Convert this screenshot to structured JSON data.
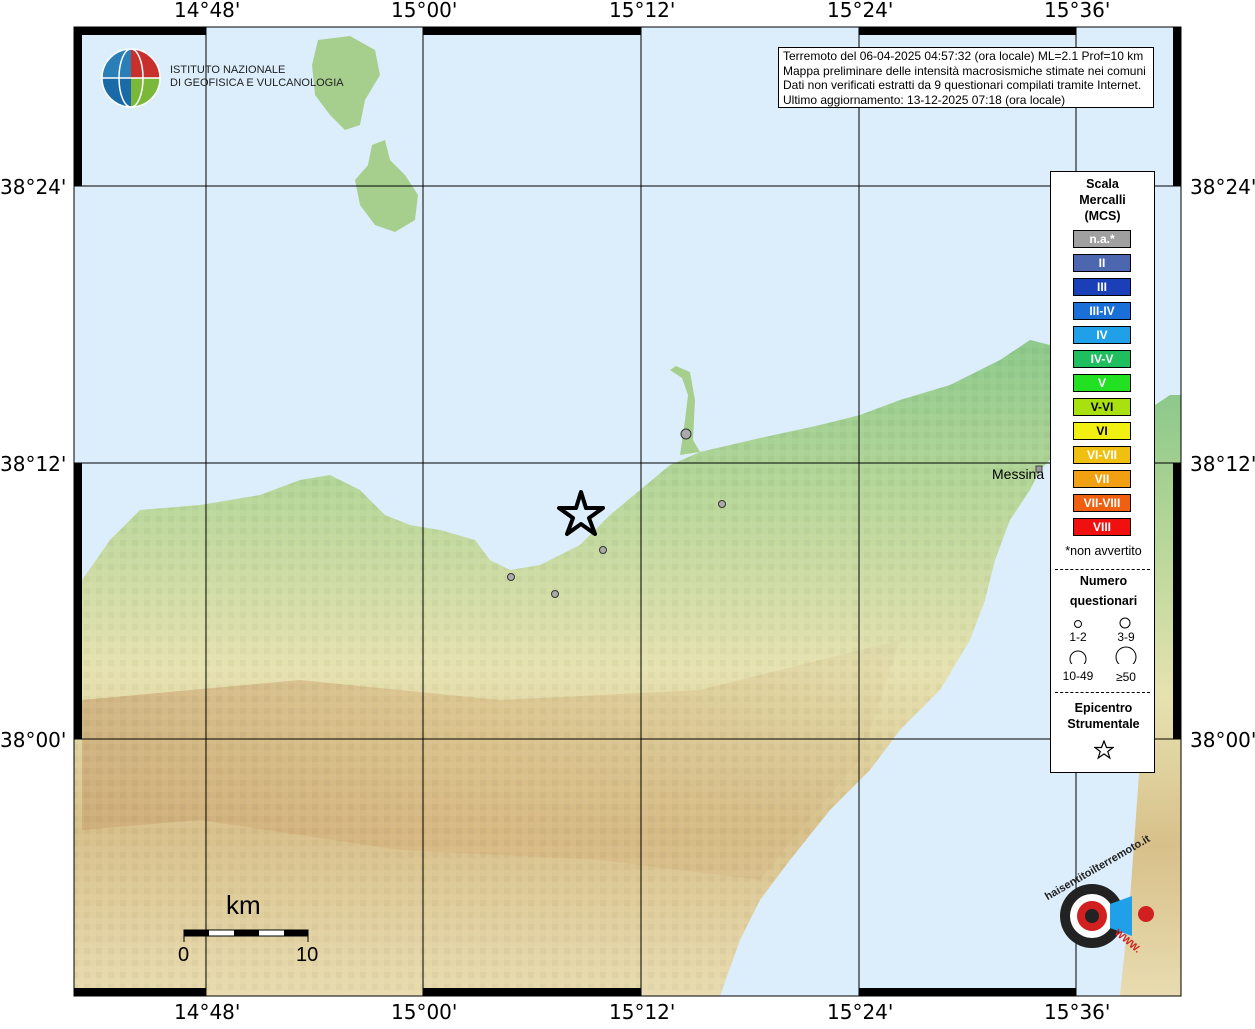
{
  "header": {
    "lon_labels": [
      "14°48'",
      "15°00'",
      "15°12'",
      "15°24'",
      "15°36'"
    ],
    "lat_labels": [
      "38°24'",
      "38°12'",
      "38°00'"
    ]
  },
  "info": {
    "line1": "Terremoto del 06-04-2025 04:57:32 (ora locale) ML=2.1 Prof=10 km",
    "line2": "Mappa preliminare delle intensità macrosismiche stimate nei comuni",
    "line3": "Dati non verificati estratti da 9 questionari compilati tramite Internet.",
    "line4": "Ultimo aggiornamento: 13-12-2025 07:18 (ora locale)"
  },
  "logo": {
    "line1": "ISTITUTO NAZIONALE",
    "line2": "DI GEOFISICA E VULCANOLOGIA"
  },
  "legend": {
    "title1": "Scala",
    "title2": "Mercalli",
    "title3": "(MCS)",
    "levels": [
      {
        "label": "n.a.*",
        "color": "#a0a0a0"
      },
      {
        "label": "II",
        "color": "#4c66b0"
      },
      {
        "label": "III",
        "color": "#1a3fb8"
      },
      {
        "label": "III-IV",
        "color": "#1a6fd8"
      },
      {
        "label": "IV",
        "color": "#1fa0e8"
      },
      {
        "label": "IV-V",
        "color": "#1fbf5f"
      },
      {
        "label": "V",
        "color": "#22e022"
      },
      {
        "label": "V-VI",
        "color": "#a8e010"
      },
      {
        "label": "VI",
        "color": "#f2f010"
      },
      {
        "label": "VI-VII",
        "color": "#f0c010"
      },
      {
        "label": "VII",
        "color": "#f0a010"
      },
      {
        "label": "VII-VIII",
        "color": "#f06010"
      },
      {
        "label": "VIII",
        "color": "#f01010"
      }
    ],
    "note": "*non avvertito",
    "count_title1": "Numero",
    "count_title2": "questionari",
    "sizes": [
      "1-2",
      "3-9",
      "10-49",
      "≥50"
    ],
    "epic_title1": "Epicentro",
    "epic_title2": "Strumentale"
  },
  "places": {
    "messina": "Messina"
  },
  "scale_bar": {
    "unit": "km",
    "start": "0",
    "end": "10"
  },
  "brand": {
    "text": "haisentitoilterremoto.it",
    "www": "WWW."
  }
}
